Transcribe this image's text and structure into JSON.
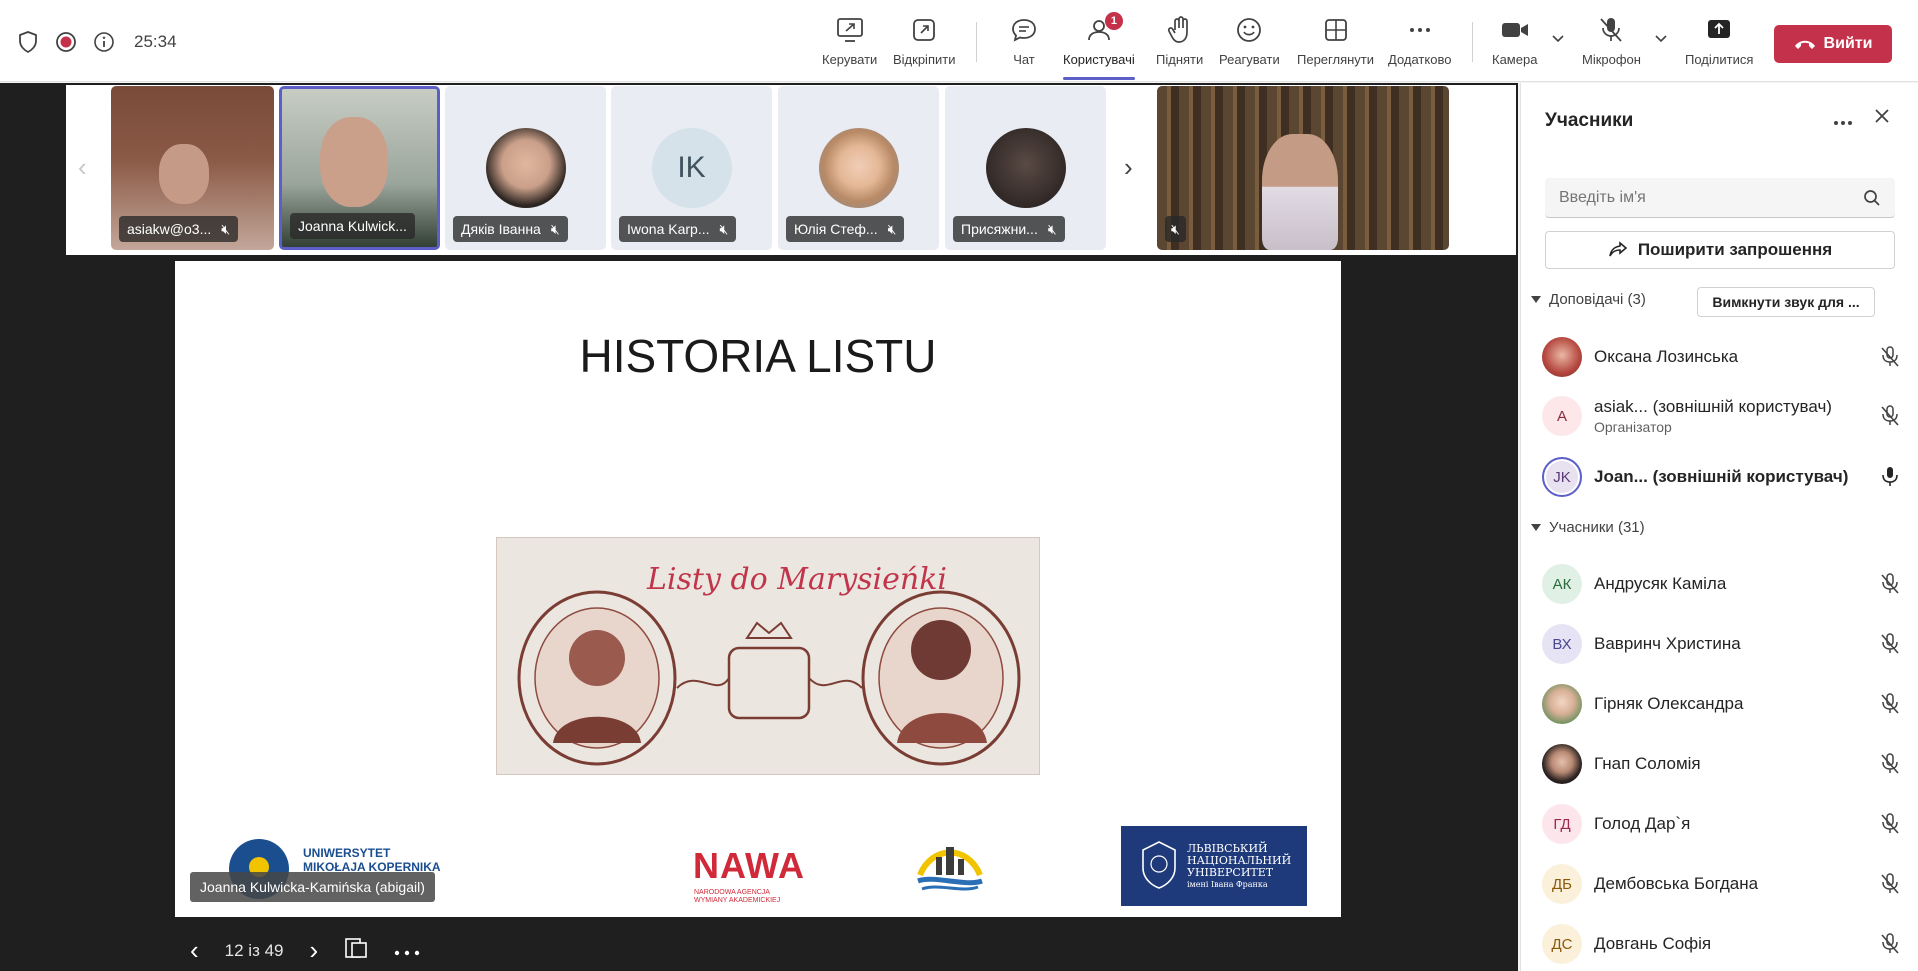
{
  "topbar": {
    "timer": "25:34",
    "buttons": {
      "manage": "Керувати",
      "unpin": "Відкріпити",
      "chat": "Чат",
      "people": "Користувачі",
      "people_badge": "1",
      "raise": "Підняти",
      "react": "Реагувати",
      "view": "Переглянути",
      "more": "Додатково",
      "camera": "Камера",
      "mic": "Мікрофон",
      "share": "Поділитися"
    },
    "leave": "Вийти"
  },
  "gallery": {
    "tiles": [
      {
        "name": "asiakw@o3..."
      },
      {
        "name": "Joanna Kulwick..."
      },
      {
        "name": "Дяків Іванна"
      },
      {
        "name": "Iwona Karp...",
        "initials": "IK"
      },
      {
        "name": "Юлія Стеф..."
      },
      {
        "name": "Присяжни..."
      }
    ]
  },
  "slide": {
    "title": "HISTORIA LISTU",
    "image_caption": "Listy do Marysieńki",
    "presenter": "Joanna Kulwicka-Kamińska (abigail)",
    "page_indicator": "12 із 49",
    "logos": {
      "umk_line1": "UNIWERSYTET",
      "umk_line2": "MIKOŁAJA KOPERNIKA",
      "nawa": "NAWA",
      "nawa_sub1": "NARODOWA AGENCJA",
      "nawa_sub2": "WYMIANY AKADEMICKIEJ",
      "lnu_line1": "ЛЬВІВСЬКИЙ",
      "lnu_line2": "НАЦІОНАЛЬНИЙ",
      "lnu_line3": "УНІВЕРСИТЕТ",
      "lnu_line4": "імені Івана Франка"
    }
  },
  "panel": {
    "title": "Учасники",
    "search_placeholder": "Введіть ім'я",
    "share_invite": "Поширити запрошення",
    "presenters_label": "Доповідачі (3)",
    "mute_all": "Вимкнути звук для ...",
    "attendees_label": "Учасники (31)",
    "presenters": [
      {
        "name": "Оксана Лозинська"
      },
      {
        "name": "asiak...  (зовнішній користувач)",
        "sub": "Організатор",
        "initials": "A"
      },
      {
        "name": "Joan... (зовнішній користувач)",
        "initials": "JK"
      }
    ],
    "attendees": [
      {
        "name": "Андрусяк Каміла",
        "initials": "АК"
      },
      {
        "name": "Вавринч Христина",
        "initials": "ВХ"
      },
      {
        "name": "Гірняк Олександра"
      },
      {
        "name": "Гнап Соломія"
      },
      {
        "name": "Голод Дар`я",
        "initials": "ГД"
      },
      {
        "name": "Дембовська Богдана",
        "initials": "ДБ"
      },
      {
        "name": "Довгань Софія",
        "initials": "ДС"
      }
    ]
  }
}
